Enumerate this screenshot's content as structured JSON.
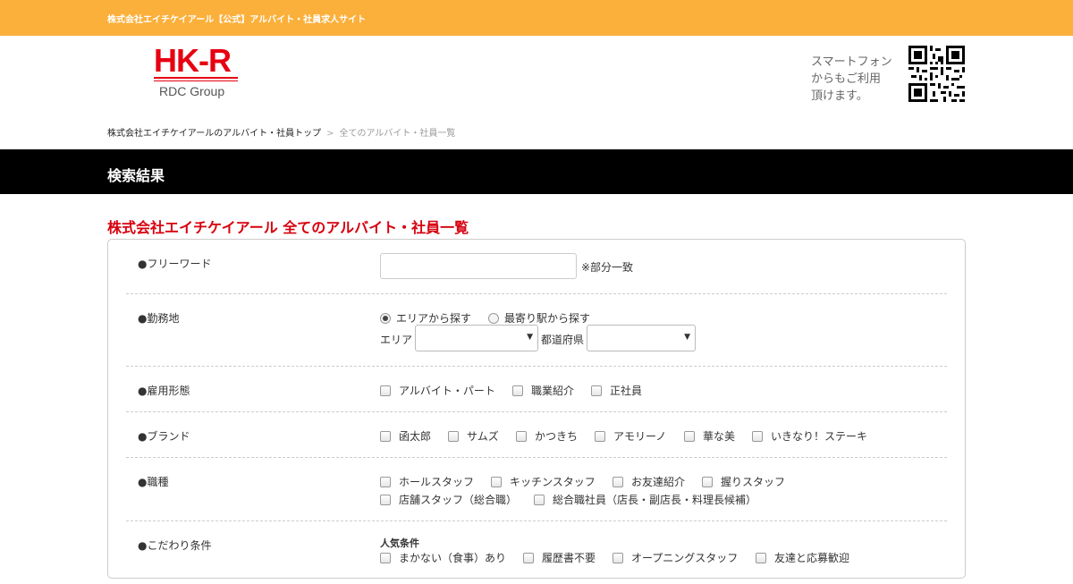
{
  "header": {
    "site_title": "株式会社エイチケイアール【公式】アルバイト・社員求人サイト",
    "logo_mark": "HK-R",
    "logo_sub": "RDC Group",
    "qr_text_1": "スマートフォン",
    "qr_text_2": "からもご利用",
    "qr_text_3": "頂けます。"
  },
  "breadcrumb": {
    "home": "株式会社エイチケイアールのアルバイト・社員トップ",
    "sep": ">",
    "current": "全てのアルバイト・社員一覧"
  },
  "banner": {
    "title": "検索結果"
  },
  "page": {
    "heading": "株式会社エイチケイアール 全てのアルバイト・社員一覧"
  },
  "search": {
    "freeword": {
      "label": "●フリーワード",
      "value": "",
      "placeholder": "",
      "note": "※部分一致"
    },
    "location": {
      "label": "●勤務地",
      "radio_area": "エリアから探す",
      "radio_station": "最寄り駅から探す",
      "selected": "エリアから探す",
      "area_label": "エリア",
      "area_value": "",
      "pref_label": "都道府県",
      "pref_value": ""
    },
    "employment": {
      "label": "●雇用形態",
      "options": [
        "アルバイト・パート",
        "職業紹介",
        "正社員"
      ]
    },
    "brand": {
      "label": "●ブランド",
      "options": [
        "函太郎",
        "サムズ",
        "かつきち",
        "アモリーノ",
        "華な美",
        "いきなり！ステーキ"
      ]
    },
    "job": {
      "label": "●職種",
      "options_row1": [
        "ホールスタッフ",
        "キッチンスタッフ",
        "お友達紹介",
        "握りスタッフ"
      ],
      "options_row2": [
        "店舗スタッフ（総合職）",
        "総合職社員（店長・副店長・料理長候補）"
      ]
    },
    "conditions": {
      "label": "●こだわり条件",
      "group_title": "人気条件",
      "options": [
        "まかない（食事）あり",
        "履歴書不要",
        "オープニングスタッフ",
        "友達と応募歓迎"
      ]
    }
  },
  "colors": {
    "topbar": "#fbb03b",
    "brand_red": "#e60012",
    "heading_red": "#d7000f",
    "banner": "#000000"
  },
  "icons": {
    "qr": "qr-code-icon",
    "select": "chevron-down-icon"
  }
}
